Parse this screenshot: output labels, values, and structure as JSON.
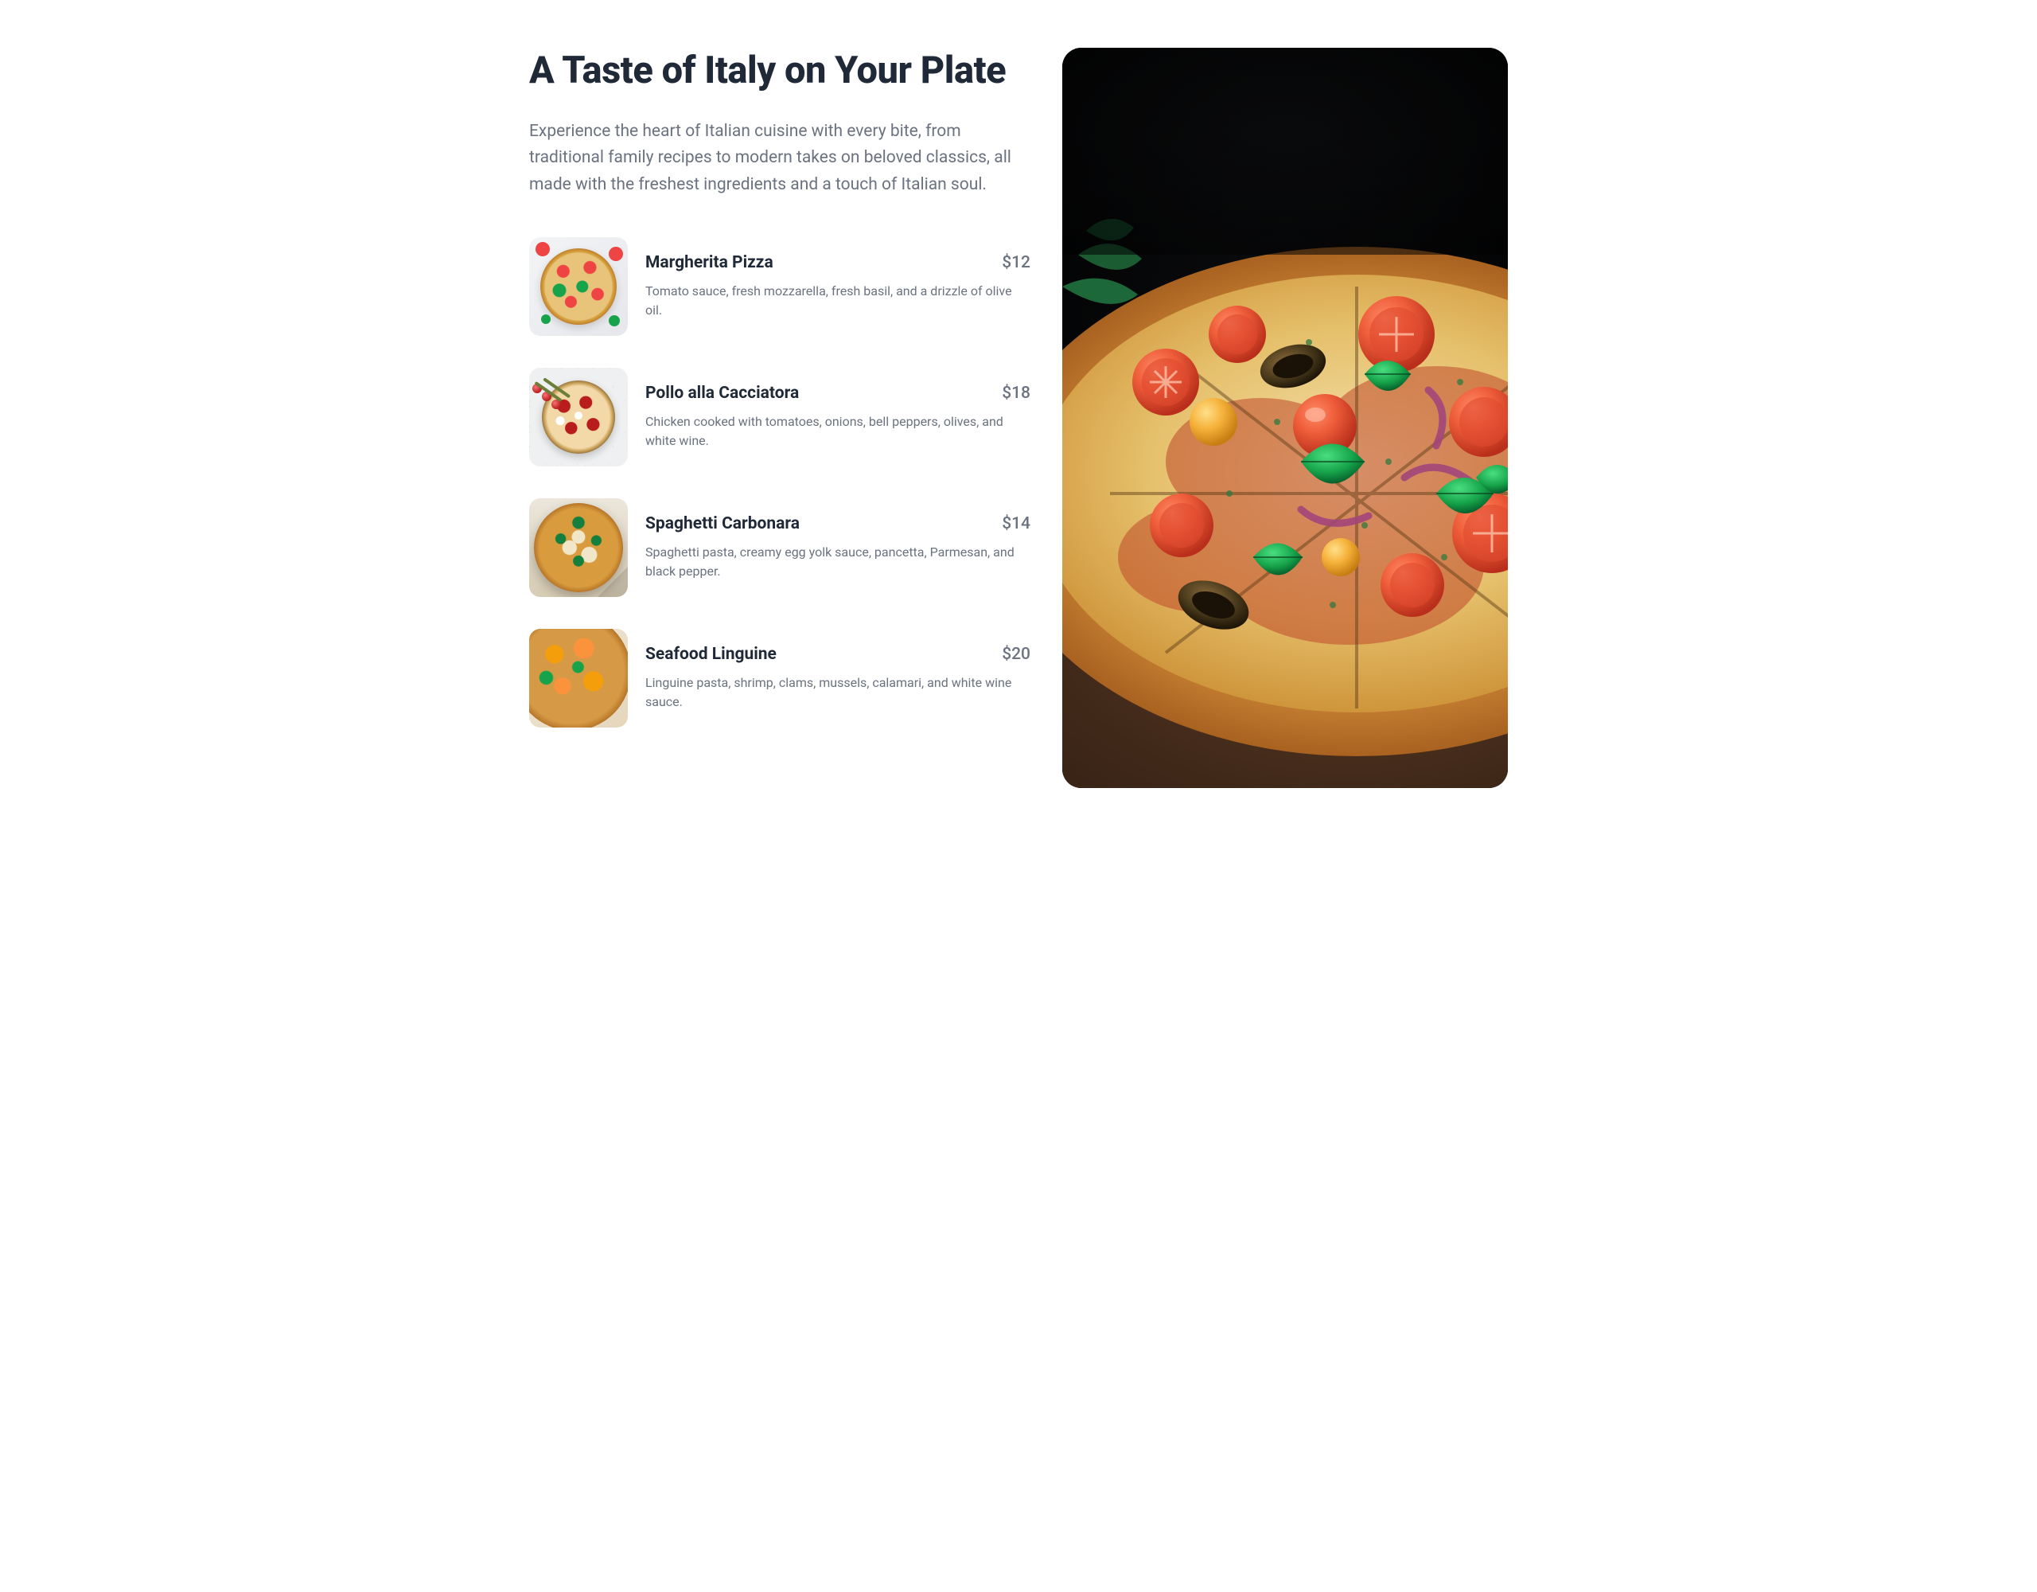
{
  "hero": {
    "title": "A Taste of Italy on Your Plate",
    "subtitle": "Experience the heart of Italian cuisine with every bite, from traditional family recipes to modern takes on beloved classics, all made with the freshest ingredients and a touch of Italian soul."
  },
  "menu": {
    "items": [
      {
        "name": "Margherita Pizza",
        "price": "$12",
        "description": "Tomato sauce, fresh mozzarella, fresh basil, and a drizzle of olive oil."
      },
      {
        "name": "Pollo alla Cacciatora",
        "price": "$18",
        "description": "Chicken cooked with tomatoes, onions, bell peppers, olives, and white wine."
      },
      {
        "name": "Spaghetti Carbonara",
        "price": "$14",
        "description": "Spaghetti pasta, creamy egg yolk sauce, pancetta, Parmesan, and black pepper."
      },
      {
        "name": "Seafood Linguine",
        "price": "$20",
        "description": "Linguine pasta, shrimp, clams, mussels, calamari, and white wine sauce."
      }
    ]
  }
}
